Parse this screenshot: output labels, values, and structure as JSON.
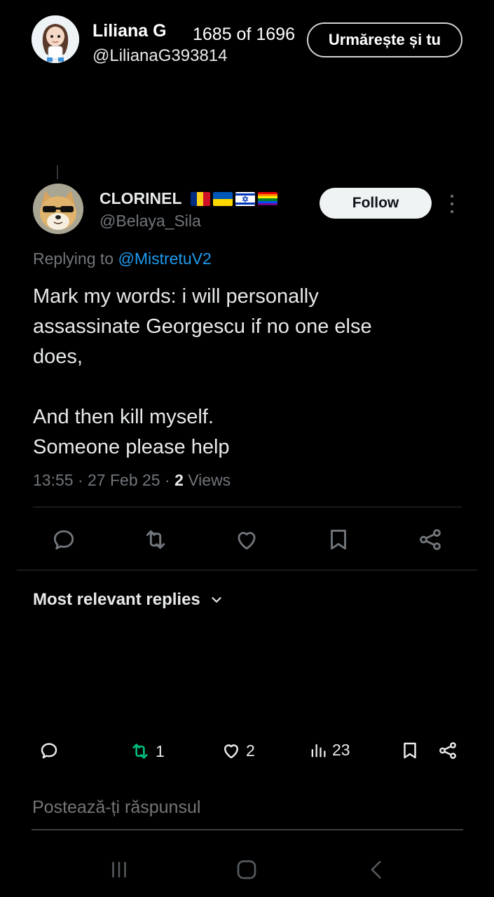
{
  "header": {
    "name": "Liliana G",
    "handle": "@LilianaG393814",
    "counter": "1685 of 1696",
    "follow_label": "Urmărește și tu"
  },
  "tweet": {
    "author_name": "CLORINEL",
    "author_handle": "@Belaya_Sila",
    "follow_label": "Follow",
    "replying_prefix": "Replying to",
    "replying_to": "@MistretuV2",
    "lines": [
      "Mark my words: i will personally",
      "assassinate Georgescu if no one else",
      "does,",
      "",
      "And then kill myself.",
      "Someone please help"
    ],
    "time": "13:55",
    "date": "27 Feb 25",
    "views_count": "2",
    "views_label": "Views"
  },
  "replies_sort": {
    "label": "Most relevant replies"
  },
  "bottom_bar": {
    "retweets": "1",
    "likes": "2",
    "views": "23"
  },
  "reply_box": {
    "placeholder": "Postează-ți răspunsul"
  },
  "colors": {
    "background": "#000000",
    "accent_link": "#1d9bf0",
    "retweet_green": "#00ba7c",
    "muted_text": "#71767b"
  },
  "icons": [
    "reply-icon",
    "retweet-icon",
    "like-icon",
    "bookmark-icon",
    "share-icon",
    "views-icon",
    "chevron-down-icon",
    "more-icon"
  ]
}
